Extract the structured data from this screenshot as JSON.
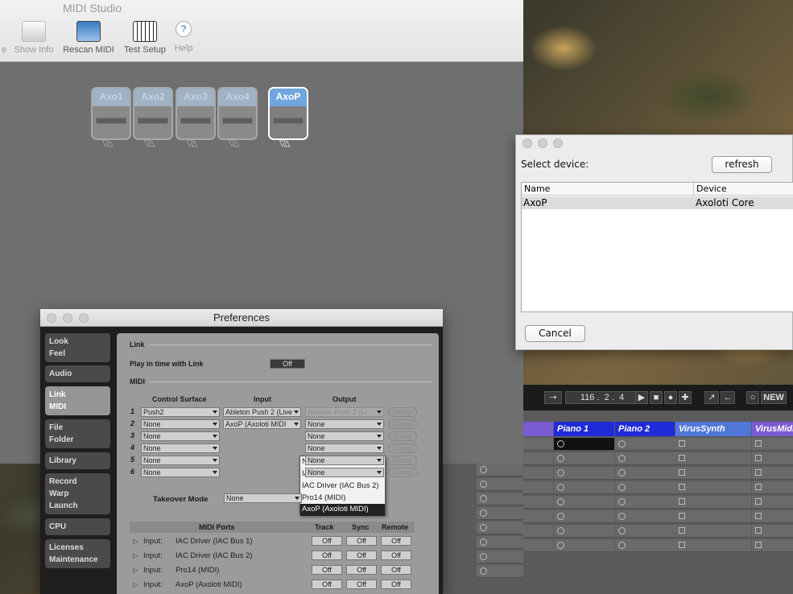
{
  "midi_studio": {
    "title": "MIDI Studio",
    "toolbar": [
      {
        "label": "e"
      },
      {
        "label": "Show Info"
      },
      {
        "label": "Rescan MIDI"
      },
      {
        "label": "Test Setup"
      },
      {
        "label": "Help"
      }
    ],
    "devices": [
      "Axo1",
      "Axo2",
      "Axo3",
      "Axo4",
      "AxoP"
    ],
    "ports_glyph": "▽△"
  },
  "select_device": {
    "label": "Select device:",
    "refresh_label": "refresh",
    "columns": [
      "Name",
      "Device"
    ],
    "rows": [
      {
        "name": "AxoP",
        "device": "Axoloti Core"
      }
    ],
    "cancel_label": "Cancel"
  },
  "live": {
    "tempo": "116",
    "pos1": "2",
    "pos2": "4",
    "new_label": "NEW",
    "tracks": [
      {
        "name": "Piano 1",
        "color": "#1f2bd6"
      },
      {
        "name": "Piano 2",
        "color": "#1f2bd6"
      },
      {
        "name": "VirusSynth",
        "color": "#4f77d8"
      },
      {
        "name": "VirusMidi",
        "color": "#7b5bd4"
      }
    ]
  },
  "prefs": {
    "title": "Preferences",
    "tabs": [
      [
        "Look",
        "Feel"
      ],
      [
        "Audio"
      ],
      [
        "Link",
        "MIDI"
      ],
      [
        "File",
        "Folder"
      ],
      [
        "Library"
      ],
      [
        "Record",
        "Warp",
        "Launch"
      ],
      [
        "CPU"
      ],
      [
        "Licenses",
        "Maintenance"
      ]
    ],
    "link_section": "Link",
    "play_in_time_label": "Play in time with Link",
    "play_in_time_value": "Off",
    "midi_section": "MIDI",
    "col_control_surface": "Control Surface",
    "col_input": "Input",
    "col_output": "Output",
    "rows": [
      {
        "n": "1",
        "cs": "Push2",
        "in": "Ableton Push 2 (Live",
        "out": "Ableton Push 2 (Li"
      },
      {
        "n": "2",
        "cs": "None",
        "in": "AxoP (Axoloti MIDI",
        "out": "None"
      },
      {
        "n": "3",
        "cs": "None",
        "in": "",
        "out": "None"
      },
      {
        "n": "4",
        "cs": "None",
        "in": "",
        "out": "None"
      },
      {
        "n": "5",
        "cs": "None",
        "in": "",
        "out": "None"
      },
      {
        "n": "6",
        "cs": "None",
        "in": "",
        "out": "None"
      }
    ],
    "dump_label": "Dump",
    "dropdown": [
      "None",
      "IAC Driver (IAC Bus 1)",
      "IAC Driver (IAC Bus 2)",
      "Pro14 (MIDI)",
      "AxoP (Axoloti MIDI)"
    ],
    "takeover_label": "Takeover Mode",
    "takeover_value": "None",
    "ports_header": {
      "midi_ports": "MIDI Ports",
      "track": "Track",
      "sync": "Sync",
      "remote": "Remote"
    },
    "ports": [
      {
        "dir": "Input:",
        "name": "IAC Driver (IAC Bus 1)",
        "track": "Off",
        "sync": "Off",
        "remote": "Off"
      },
      {
        "dir": "Input:",
        "name": "IAC Driver (IAC Bus 2)",
        "track": "Off",
        "sync": "Off",
        "remote": "Off"
      },
      {
        "dir": "Input:",
        "name": "Pro14 (MIDI)",
        "track": "Off",
        "sync": "Off",
        "remote": "Off"
      },
      {
        "dir": "Input:",
        "name": "AxoP (Axoloti MIDI)",
        "track": "Off",
        "sync": "Off",
        "remote": "Off"
      }
    ]
  }
}
